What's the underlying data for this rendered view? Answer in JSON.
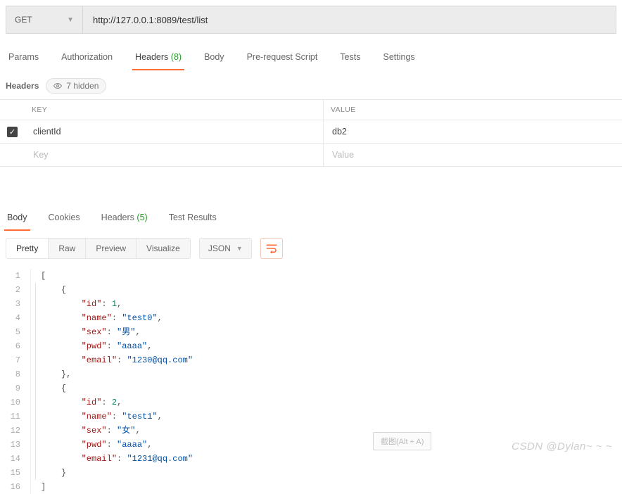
{
  "request": {
    "method": "GET",
    "url": "http://127.0.0.1:8089/test/list"
  },
  "requestTabs": {
    "params": "Params",
    "authorization": "Authorization",
    "headers_label": "Headers",
    "headers_count": "(8)",
    "body": "Body",
    "prerequest": "Pre-request Script",
    "tests": "Tests",
    "settings": "Settings"
  },
  "headersArea": {
    "title": "Headers",
    "hidden_label": "7 hidden",
    "col_key": "KEY",
    "col_value": "VALUE",
    "rows": [
      {
        "checked": true,
        "key": "clientId",
        "value": "db2"
      }
    ],
    "key_placeholder": "Key",
    "value_placeholder": "Value"
  },
  "responseTabs": {
    "body": "Body",
    "cookies": "Cookies",
    "headers_label": "Headers",
    "headers_count": "(5)",
    "testresults": "Test Results"
  },
  "viewModes": {
    "pretty": "Pretty",
    "raw": "Raw",
    "preview": "Preview",
    "visualize": "Visualize",
    "lang": "JSON"
  },
  "responseBody": [
    {
      "id": 1,
      "name": "test0",
      "sex": "男",
      "pwd": "aaaa",
      "email": "1230@qq.com"
    },
    {
      "id": 2,
      "name": "test1",
      "sex": "女",
      "pwd": "aaaa",
      "email": "1231@qq.com"
    }
  ],
  "tooltip": "截图(Alt + A)",
  "watermark": "CSDN @Dylan~ ~ ~"
}
